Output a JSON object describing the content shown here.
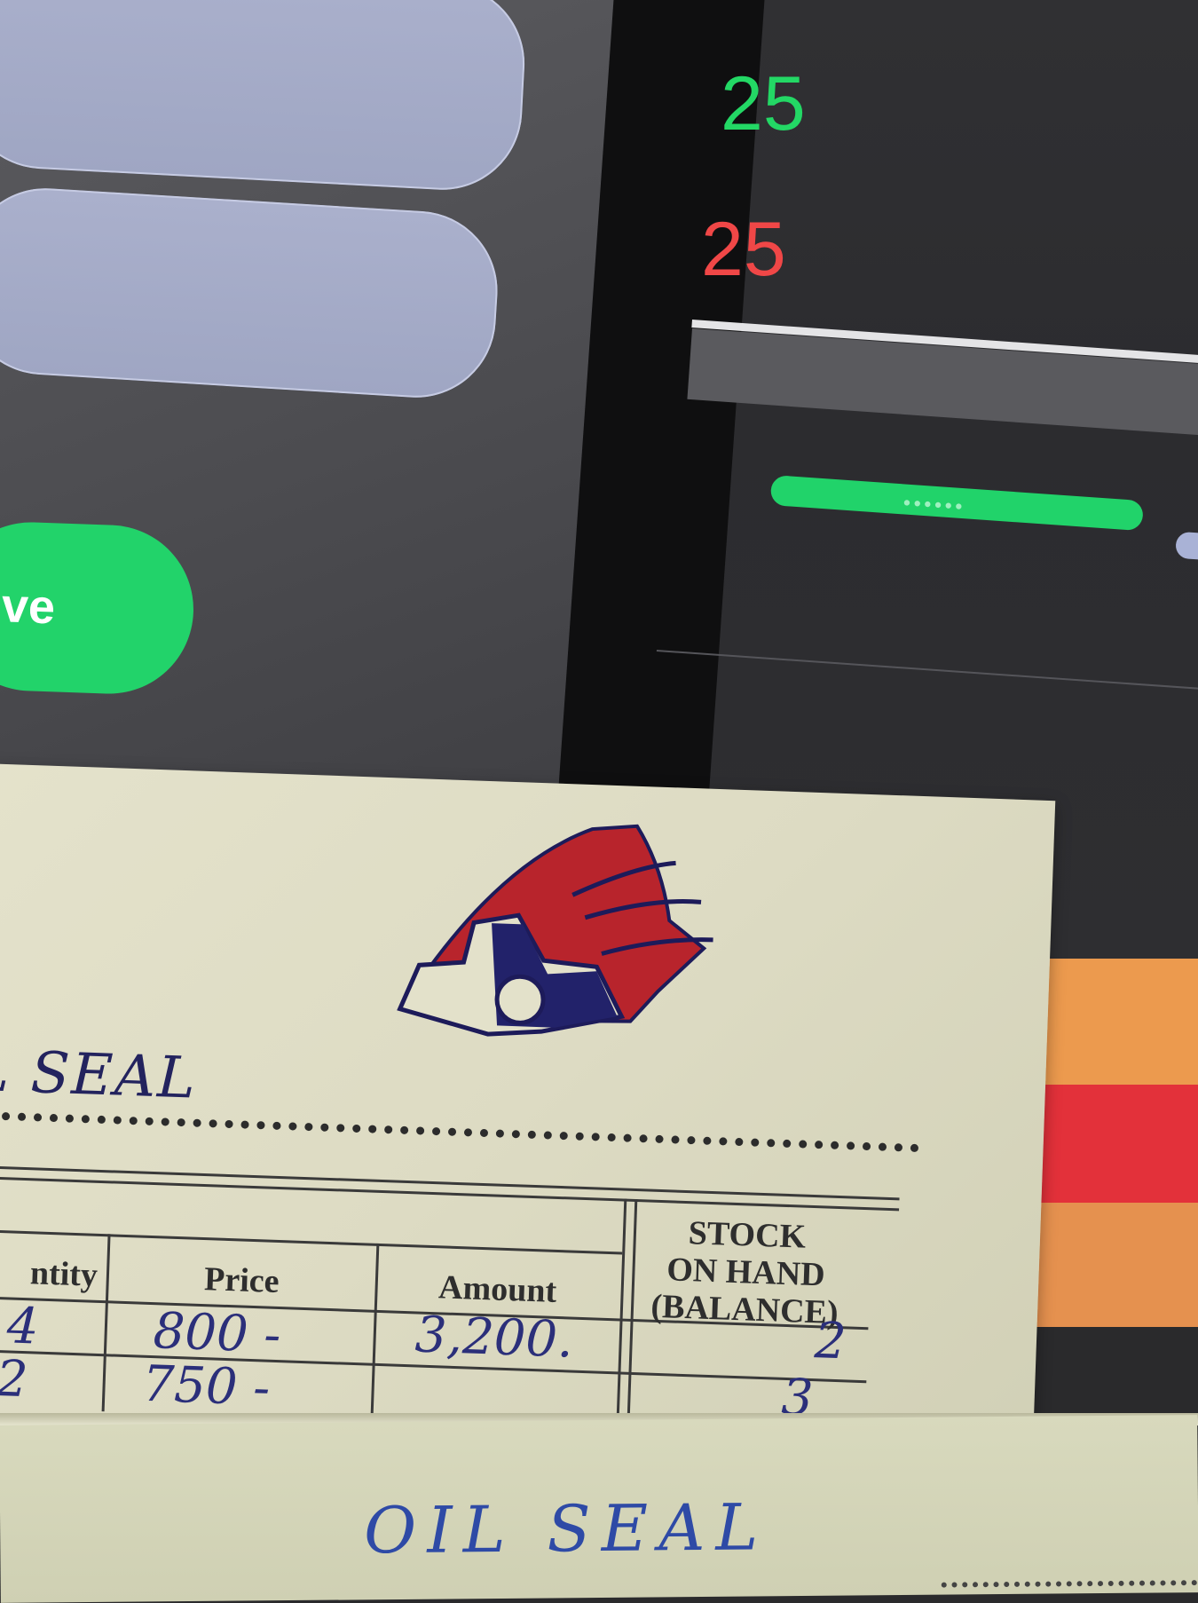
{
  "monitor": {
    "save_button_label": "ve",
    "value_green": "25",
    "value_red": "25",
    "progress_dots": "••••••",
    "colors": {
      "input_fill": "#a3a9c6",
      "save_button": "#22d36a",
      "positive": "#23d865",
      "negative": "#f04747",
      "progress": "#21d36a",
      "stripe_orange": "#ec9a4e",
      "stripe_red": "#e3313a"
    }
  },
  "stock_card": {
    "item_name": "L SEAL",
    "drawing": "red-blue-seal-profile-sketch",
    "headers": {
      "quantity": "ntity",
      "price": "Price",
      "amount": "Amount",
      "stock_line1": "STOCK",
      "stock_line2": "ON HAND",
      "stock_line3": "(BALANCE)"
    },
    "rows": [
      {
        "quantity": "4",
        "price": "800 -",
        "amount": "3,200.",
        "balance": "2"
      },
      {
        "quantity": "2",
        "price": "750 -",
        "amount": "",
        "balance": "3"
      }
    ],
    "ink_color": "#2b2f7a"
  },
  "envelope": {
    "label": "OIL SEAL"
  }
}
